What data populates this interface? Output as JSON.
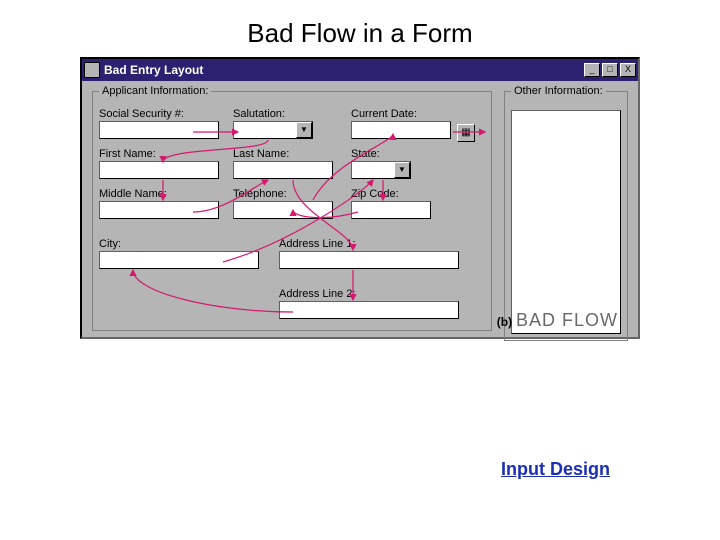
{
  "slide": {
    "title": "Bad Flow in a Form"
  },
  "window": {
    "title": "Bad Entry Layout",
    "minimize_glyph": "_",
    "maximize_glyph": "□",
    "close_glyph": "X"
  },
  "groups": {
    "applicant_legend": "Applicant Information:",
    "other_legend": "Other Information:"
  },
  "fields": {
    "ssn": "Social Security #:",
    "salutation": "Salutation:",
    "current_date": "Current Date:",
    "first_name": "First Name:",
    "last_name": "Last Name:",
    "state": "State:",
    "middle_name": "Middle Name:",
    "telephone": "Telephone:",
    "zip": "Zip Code:",
    "city": "City:",
    "addr1": "Address Line 1:",
    "addr2": "Address Line 2:"
  },
  "caption": {
    "prefix": "(b)",
    "text": "BAD FLOW"
  },
  "footer": {
    "link": "Input Design"
  },
  "icons": {
    "date_btn": "▦",
    "dropdown": "▼"
  },
  "colors": {
    "arrow": "#d6186f",
    "titlebar": "#2c2170"
  }
}
